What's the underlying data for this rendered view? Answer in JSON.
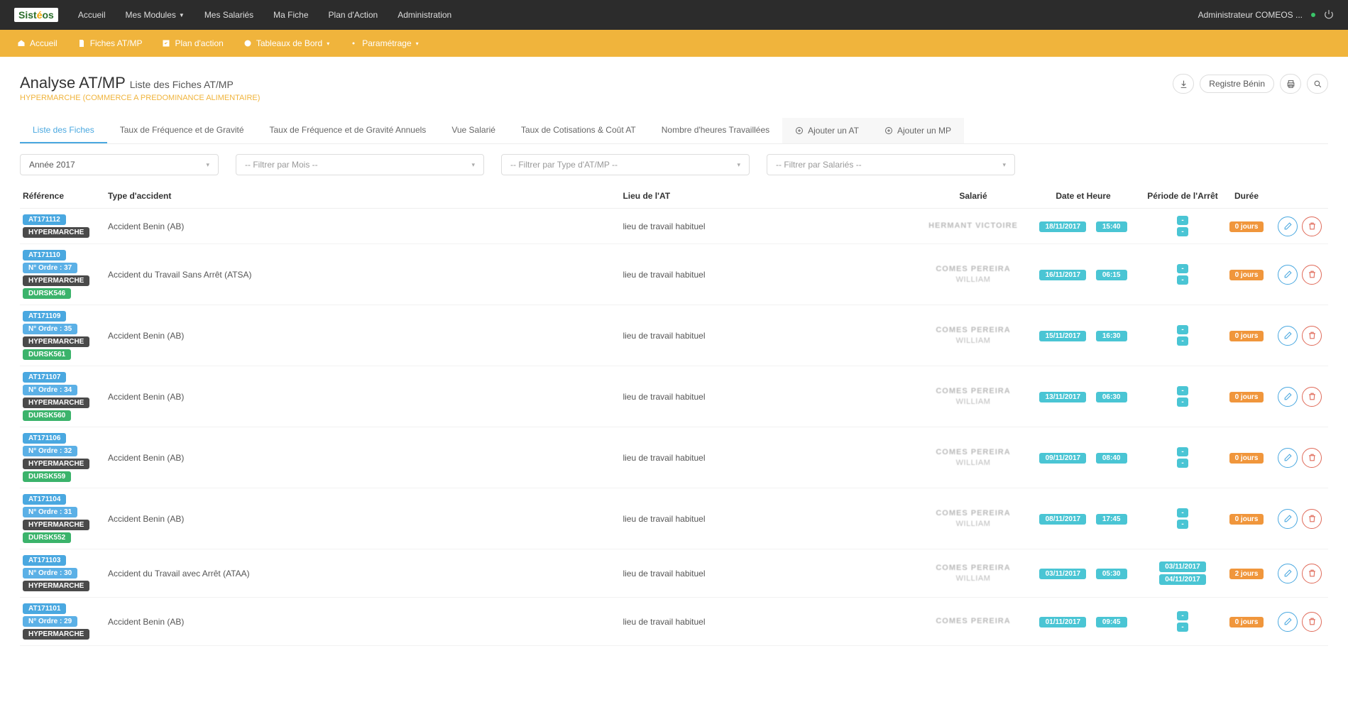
{
  "topnav": {
    "items": [
      "Accueil",
      "Mes Modules",
      "Mes Salariés",
      "Ma Fiche",
      "Plan d'Action",
      "Administration"
    ],
    "user": "Administrateur COMEOS ..."
  },
  "secondnav": {
    "items": [
      "Accueil",
      "Fiches AT/MP",
      "Plan d'action",
      "Tableaux de Bord",
      "Paramétrage"
    ]
  },
  "page": {
    "title": "Analyse AT/MP",
    "subtitle": "Liste des Fiches AT/MP",
    "tag": "HYPERMARCHE (COMMERCE A PREDOMINANCE ALIMENTAIRE)",
    "registre": "Registre Bénin"
  },
  "tabs": [
    "Liste des Fiches",
    "Taux de Fréquence et de Gravité",
    "Taux de Fréquence et de Gravité Annuels",
    "Vue Salarié",
    "Taux de Cotisations & Coût AT",
    "Nombre d'heures Travaillées",
    "Ajouter un AT",
    "Ajouter un MP"
  ],
  "filters": {
    "year": "Année 2017",
    "month": "-- Filtrer par Mois --",
    "type": "-- Filtrer par Type d'AT/MP --",
    "salarie": "-- Filtrer par Salariés --"
  },
  "columns": [
    "Référence",
    "Type d'accident",
    "Lieu de l'AT",
    "Salarié",
    "Date et Heure",
    "Période de l'Arrêt",
    "Durée"
  ],
  "rows": [
    {
      "ref": "AT171112",
      "ordre": "",
      "site": "HYPERMARCHE",
      "code": "",
      "type": "Accident Benin (AB)",
      "lieu": "lieu de travail habituel",
      "emp1": "HERMANT VICTOIRE",
      "emp2": "",
      "date": "18/11/2017",
      "time": "15:40",
      "pstart": "-",
      "pend": "-",
      "dur": "0 jours"
    },
    {
      "ref": "AT171110",
      "ordre": "N° Ordre : 37",
      "site": "HYPERMARCHE",
      "code": "DURSK546",
      "type": "Accident du Travail Sans Arrêt (ATSA)",
      "lieu": "lieu de travail habituel",
      "emp1": "COMES PEREIRA",
      "emp2": "WILLIAM",
      "date": "16/11/2017",
      "time": "06:15",
      "pstart": "-",
      "pend": "-",
      "dur": "0 jours"
    },
    {
      "ref": "AT171109",
      "ordre": "N° Ordre : 35",
      "site": "HYPERMARCHE",
      "code": "DURSK561",
      "type": "Accident Benin (AB)",
      "lieu": "lieu de travail habituel",
      "emp1": "COMES PEREIRA",
      "emp2": "WILLIAM",
      "date": "15/11/2017",
      "time": "16:30",
      "pstart": "-",
      "pend": "-",
      "dur": "0 jours"
    },
    {
      "ref": "AT171107",
      "ordre": "N° Ordre : 34",
      "site": "HYPERMARCHE",
      "code": "DURSK560",
      "type": "Accident Benin (AB)",
      "lieu": "lieu de travail habituel",
      "emp1": "COMES PEREIRA",
      "emp2": "WILLIAM",
      "date": "13/11/2017",
      "time": "06:30",
      "pstart": "-",
      "pend": "-",
      "dur": "0 jours"
    },
    {
      "ref": "AT171106",
      "ordre": "N° Ordre : 32",
      "site": "HYPERMARCHE",
      "code": "DURSK559",
      "type": "Accident Benin (AB)",
      "lieu": "lieu de travail habituel",
      "emp1": "COMES PEREIRA",
      "emp2": "WILLIAM",
      "date": "09/11/2017",
      "time": "08:40",
      "pstart": "-",
      "pend": "-",
      "dur": "0 jours"
    },
    {
      "ref": "AT171104",
      "ordre": "N° Ordre : 31",
      "site": "HYPERMARCHE",
      "code": "DURSK552",
      "type": "Accident Benin (AB)",
      "lieu": "lieu de travail habituel",
      "emp1": "COMES PEREIRA",
      "emp2": "WILLIAM",
      "date": "08/11/2017",
      "time": "17:45",
      "pstart": "-",
      "pend": "-",
      "dur": "0 jours"
    },
    {
      "ref": "AT171103",
      "ordre": "N° Ordre : 30",
      "site": "HYPERMARCHE",
      "code": "",
      "type": "Accident du Travail avec Arrêt (ATAA)",
      "lieu": "lieu de travail habituel",
      "emp1": "COMES PEREIRA",
      "emp2": "WILLIAM",
      "date": "03/11/2017",
      "time": "05:30",
      "pstart": "03/11/2017",
      "pend": "04/11/2017",
      "dur": "2 jours"
    },
    {
      "ref": "AT171101",
      "ordre": "N° Ordre : 29",
      "site": "HYPERMARCHE",
      "code": "",
      "type": "Accident Benin (AB)",
      "lieu": "lieu de travail habituel",
      "emp1": "COMES PEREIRA",
      "emp2": "",
      "date": "01/11/2017",
      "time": "09:45",
      "pstart": "-",
      "pend": "-",
      "dur": "0 jours"
    }
  ]
}
